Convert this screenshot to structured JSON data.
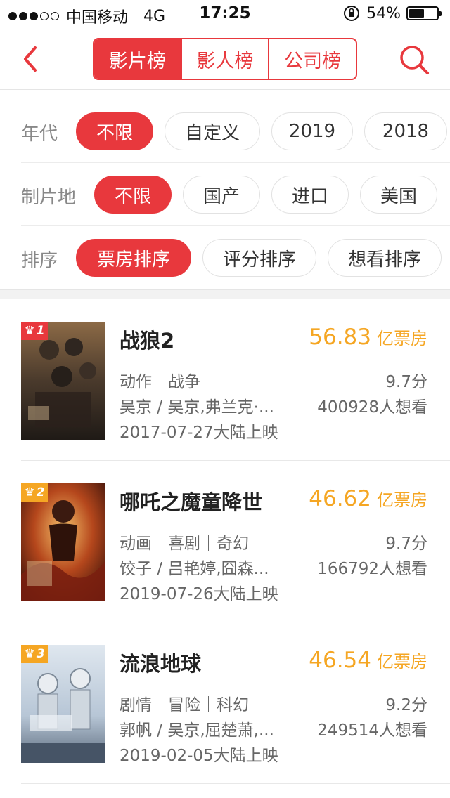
{
  "status_bar": {
    "carrier": "中国移动",
    "network": "4G",
    "time": "17:25",
    "battery": "54%",
    "battery_level": 0.54,
    "signal_bars_filled": 3
  },
  "nav": {
    "back_icon": "chevron-left-icon",
    "tabs": [
      "影片榜",
      "影人榜",
      "公司榜"
    ],
    "active_tab": 0,
    "search_icon": "search-icon",
    "accent": "#e8383d"
  },
  "filters": {
    "year": {
      "label": "年代",
      "options": [
        "不限",
        "自定义",
        "2019",
        "2018"
      ],
      "selected": 0
    },
    "region": {
      "label": "制片地",
      "options": [
        "不限",
        "国产",
        "进口",
        "美国"
      ],
      "selected": 0
    },
    "sort": {
      "label": "排序",
      "options": [
        "票房排序",
        "评分排序",
        "想看排序"
      ],
      "selected": 0
    }
  },
  "movies": [
    {
      "rank": "1",
      "title": "战狼2",
      "box_office": "56.83",
      "box_unit": "亿票房",
      "genre": "动作｜战争",
      "cast": "吴京 / 吴京,弗兰克·...",
      "release": "2017-07-27大陆上映",
      "score": "9.7分",
      "want": "400928人想看",
      "rank_color": "#e8383d"
    },
    {
      "rank": "2",
      "title": "哪吒之魔童降世",
      "box_office": "46.62",
      "box_unit": "亿票房",
      "genre": "动画｜喜剧｜奇幻",
      "cast": "饺子 / 吕艳婷,囧森...",
      "release": "2019-07-26大陆上映",
      "score": "9.7分",
      "want": "166792人想看",
      "rank_color": "#f5a623"
    },
    {
      "rank": "3",
      "title": "流浪地球",
      "box_office": "46.54",
      "box_unit": "亿票房",
      "genre": "剧情｜冒险｜科幻",
      "cast": "郭帆 / 吴京,屈楚萧,...",
      "release": "2019-02-05大陆上映",
      "score": "9.2分",
      "want": "249514人想看",
      "rank_color": "#f5a623"
    }
  ],
  "colors": {
    "accent": "#e8383d",
    "box_office": "#f5a623"
  }
}
